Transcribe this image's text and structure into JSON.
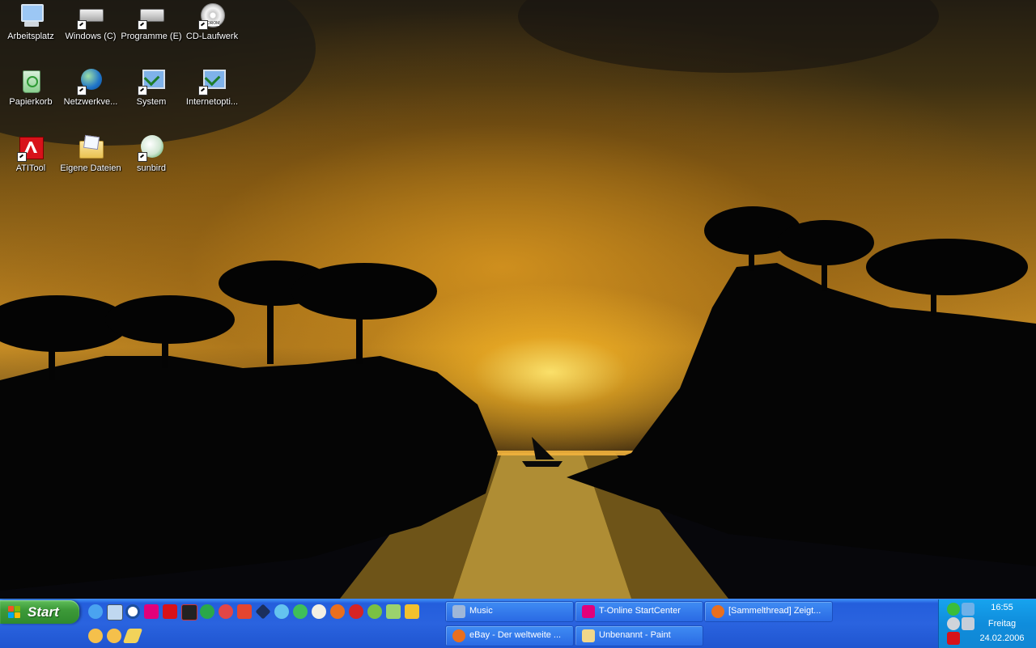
{
  "desktop": {
    "icons": [
      {
        "label": "Arbeitsplatz"
      },
      {
        "label": "Windows (C)"
      },
      {
        "label": "Programme (E)"
      },
      {
        "label": "CD-Laufwerk"
      },
      {
        "label": "Papierkorb"
      },
      {
        "label": "Netzwerkve..."
      },
      {
        "label": "System"
      },
      {
        "label": "Internetopti..."
      },
      {
        "label": "ATITool"
      },
      {
        "label": "Eigene Dateien"
      },
      {
        "label": "sunbird"
      }
    ],
    "cd_icon_text": "DROM"
  },
  "taskbar": {
    "start_label": "Start",
    "quicklaunch_row1": [
      "ie-icon",
      "display-icon",
      "media-player-icon",
      "t-online-icon",
      "atitool-icon",
      "graphics-icon",
      "puzzle-icon",
      "chat-icon",
      "paint-icon",
      "diamond-icon",
      "msn-icon",
      "network-icon",
      "mushroom-icon",
      "firefox-icon",
      "opera-icon",
      "game-icon",
      "recycle-icon",
      "folder-icon"
    ],
    "quicklaunch_row2": [
      "chat-bubble-icon",
      "chat-bubble-icon",
      "pencil-icon"
    ],
    "tasks": [
      {
        "label": "Music",
        "icon": "music-folder-icon"
      },
      {
        "label": "T-Online StartCenter",
        "icon": "t-online-icon"
      },
      {
        "label": "[Sammelthread] Zeigt...",
        "icon": "firefox-icon"
      },
      {
        "label": "eBay - Der weltweite ...",
        "icon": "firefox-icon"
      },
      {
        "label": "Unbenannt - Paint",
        "icon": "paint-icon"
      }
    ]
  },
  "tray": {
    "time": "16:55",
    "day": "Freitag",
    "date": "24.02.2006",
    "icons": [
      "clover-icon",
      "network-icon",
      "headset-icon",
      "monitor-icon",
      "antivirus-icon"
    ]
  }
}
